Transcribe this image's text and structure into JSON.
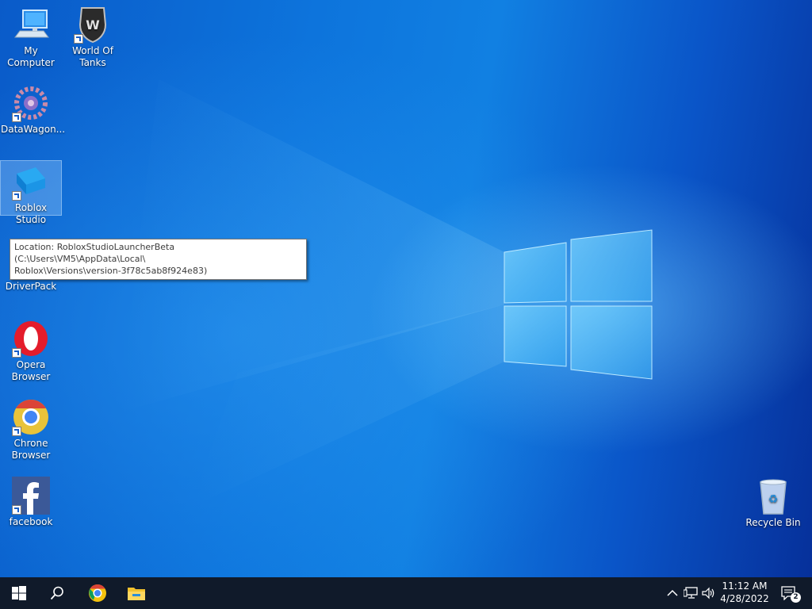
{
  "desktop": {
    "icons": [
      {
        "label": "My Computer",
        "icon": "computer-icon"
      },
      {
        "label": "World Of Tanks",
        "icon": "world-of-tanks-icon"
      },
      {
        "label": "DataWagon...",
        "icon": "datawagon-icon"
      },
      {
        "label": "Roblox Studio",
        "icon": "roblox-studio-icon"
      },
      {
        "label": "DriverPack",
        "icon": "driverpack-icon"
      },
      {
        "label": "Opera Browser",
        "icon": "opera-icon"
      },
      {
        "label": "Chrone Browser",
        "icon": "chrome-icon"
      },
      {
        "label": "facebook",
        "icon": "facebook-icon"
      },
      {
        "label": "Recycle Bin",
        "icon": "recycle-bin-icon"
      }
    ],
    "tooltip": {
      "line1": "Location: RobloxStudioLauncherBeta (C:\\Users\\VM5\\AppData\\Local\\",
      "line2": "Roblox\\Versions\\version-3f78c5ab8f924e83)"
    }
  },
  "taskbar": {
    "time": "11:12 AM",
    "date": "4/28/2022",
    "notification_count": "2",
    "pinned": [
      "start-icon",
      "search-icon",
      "chrome-icon",
      "file-explorer-icon"
    ]
  },
  "colors": {
    "taskbar": "#101a2a",
    "desktop_blue": "#0d74dc"
  }
}
